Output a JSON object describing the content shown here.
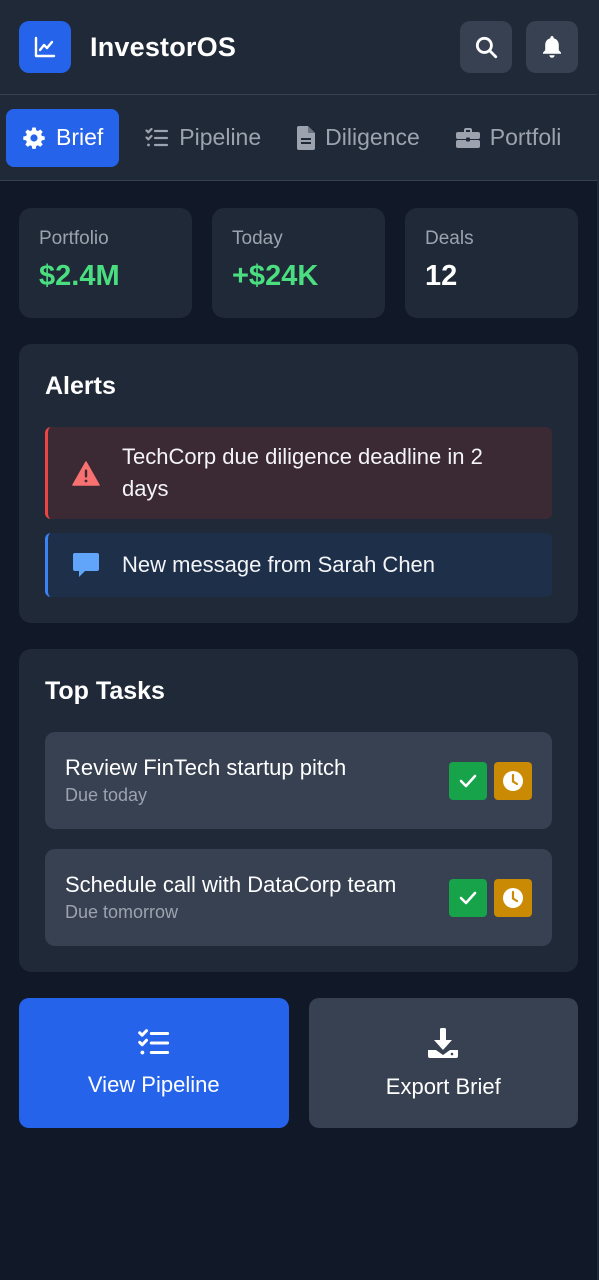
{
  "app": {
    "title": "InvestorOS"
  },
  "header": {
    "icons": [
      "chart-line-icon",
      "search-icon",
      "bell-icon"
    ]
  },
  "tabs": [
    {
      "label": "Brief",
      "icon": "gear-icon",
      "active": true
    },
    {
      "label": "Pipeline",
      "icon": "tasks-icon",
      "active": false
    },
    {
      "label": "Diligence",
      "icon": "document-icon",
      "active": false
    },
    {
      "label": "Portfoli",
      "icon": "briefcase-icon",
      "active": false
    }
  ],
  "stats": [
    {
      "label": "Portfolio",
      "value": "$2.4M"
    },
    {
      "label": "Today",
      "value": "+$24K"
    },
    {
      "label": "Deals",
      "value": "12"
    }
  ],
  "alerts": {
    "title": "Alerts",
    "items": [
      {
        "text": "TechCorp due diligence deadline in 2 days",
        "type": "danger",
        "icon": "warning-icon"
      },
      {
        "text": "New message from Sarah Chen",
        "type": "info",
        "icon": "message-icon"
      }
    ]
  },
  "tasks": {
    "title": "Top Tasks",
    "items": [
      {
        "title": "Review FinTech startup pitch",
        "due": "Due today"
      },
      {
        "title": "Schedule call with DataCorp team",
        "due": "Due tomorrow"
      }
    ]
  },
  "actions": {
    "view_pipeline": "View Pipeline",
    "export_brief": "Export Brief"
  },
  "colors": {
    "accent": "#2563eb",
    "positive": "#4ade80",
    "danger": "#ef4444",
    "info": "#3b82f6",
    "complete": "#16a34a",
    "snooze": "#ca8a04"
  }
}
